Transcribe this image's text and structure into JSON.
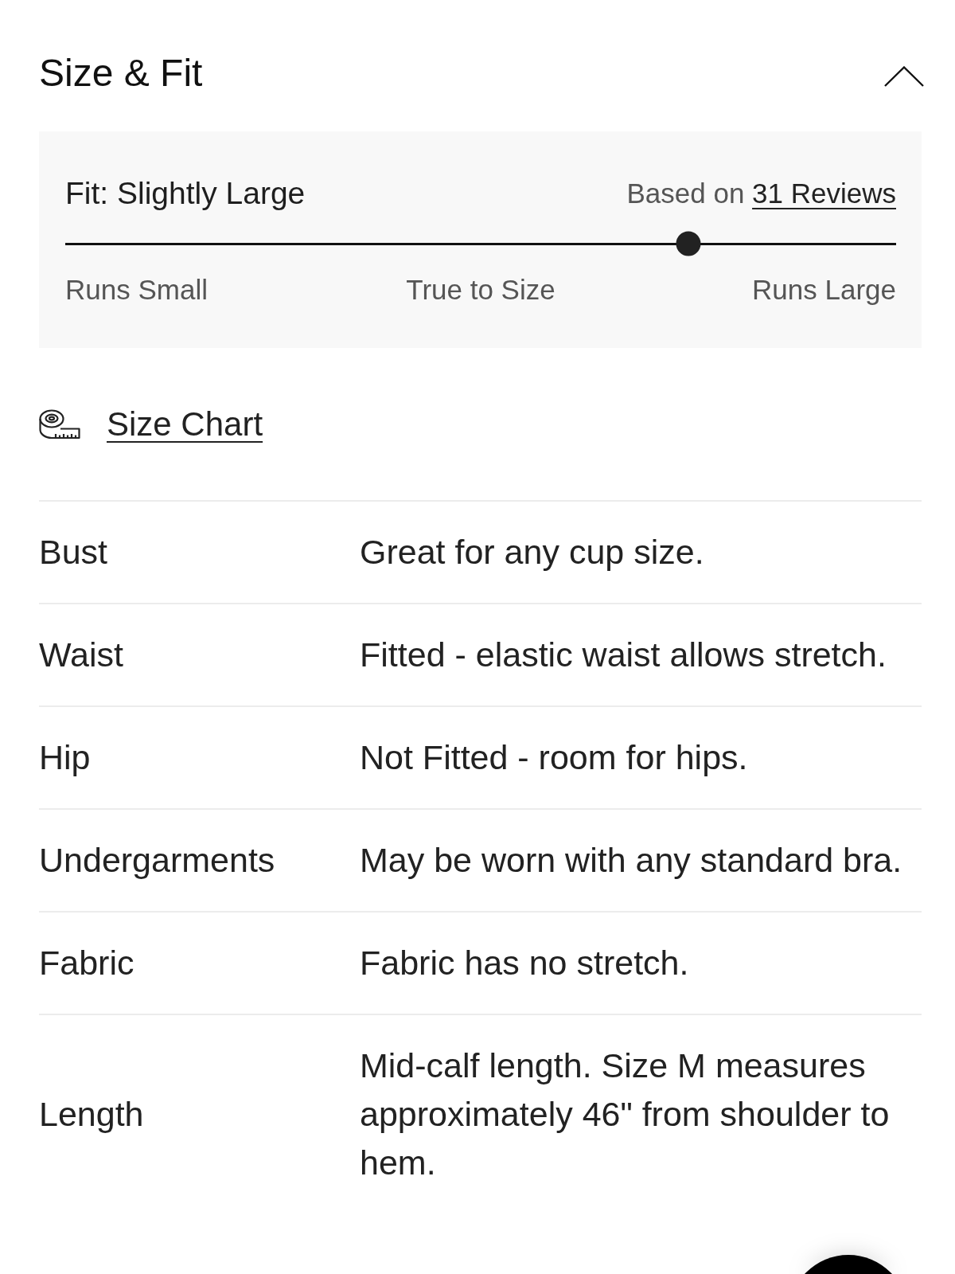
{
  "section": {
    "title": "Size & Fit",
    "expanded": true
  },
  "fit": {
    "label": "Fit: Slightly Large",
    "reviews_text": "Based on",
    "reviews_link": "31 Reviews",
    "level": 0.75,
    "scale_labels": [
      "Runs Small",
      "True to Size",
      "Runs Large"
    ]
  },
  "size_chart_link": "Size Chart",
  "details": [
    {
      "label": "Bust",
      "value": "Great for any cup size."
    },
    {
      "label": "Waist",
      "value": "Fitted - elastic waist allows stretch."
    },
    {
      "label": "Hip",
      "value": "Not Fitted - room for hips."
    },
    {
      "label": "Undergarments",
      "value": "May be worn with any standard bra."
    },
    {
      "label": "Fabric",
      "value": "Fabric has no stretch."
    },
    {
      "label": "Length",
      "value": "Mid-calf length. Size M measures approximately 46\" from shoulder to hem."
    }
  ]
}
